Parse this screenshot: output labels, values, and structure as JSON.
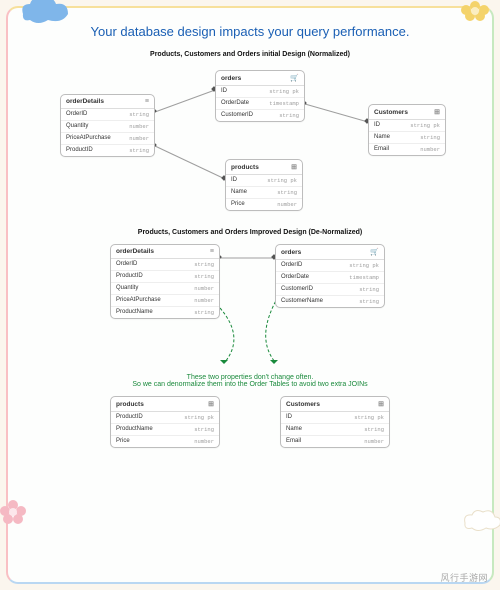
{
  "title": "Your database design impacts your query performance.",
  "section1": {
    "heading": "Products, Customers and Orders initial Design (Normalized)",
    "orderDetails": {
      "name": "orderDetails",
      "cols": [
        {
          "n": "OrderID",
          "t": "string"
        },
        {
          "n": "Quantity",
          "t": "number"
        },
        {
          "n": "PriceAtPurchase",
          "t": "number"
        },
        {
          "n": "ProductID",
          "t": "string"
        }
      ]
    },
    "orders": {
      "name": "orders",
      "cols": [
        {
          "n": "ID",
          "t": "string pk"
        },
        {
          "n": "OrderDate",
          "t": "timestamp"
        },
        {
          "n": "CustomerID",
          "t": "string"
        }
      ]
    },
    "customers": {
      "name": "Customers",
      "cols": [
        {
          "n": "ID",
          "t": "string pk"
        },
        {
          "n": "Name",
          "t": "string"
        },
        {
          "n": "Email",
          "t": "number"
        }
      ]
    },
    "products": {
      "name": "products",
      "cols": [
        {
          "n": "ID",
          "t": "string pk"
        },
        {
          "n": "Name",
          "t": "string"
        },
        {
          "n": "Price",
          "t": "number"
        }
      ]
    }
  },
  "section2": {
    "heading": "Products, Customers and Orders Improved Design (De-Normalized)",
    "orderDetails": {
      "name": "orderDetails",
      "cols": [
        {
          "n": "OrderID",
          "t": "string"
        },
        {
          "n": "ProductID",
          "t": "string"
        },
        {
          "n": "Quantity",
          "t": "number"
        },
        {
          "n": "PriceAtPurchase",
          "t": "number"
        },
        {
          "n": "ProductName",
          "t": "string"
        }
      ]
    },
    "orders": {
      "name": "orders",
      "cols": [
        {
          "n": "OrderID",
          "t": "string pk"
        },
        {
          "n": "OrderDate",
          "t": "timestamp"
        },
        {
          "n": "CustomerID",
          "t": "string"
        },
        {
          "n": "CustomerName",
          "t": "string"
        }
      ]
    },
    "products": {
      "name": "products",
      "cols": [
        {
          "n": "ProductID",
          "t": "string pk"
        },
        {
          "n": "ProductName",
          "t": "string"
        },
        {
          "n": "Price",
          "t": "number"
        }
      ]
    },
    "customers": {
      "name": "Customers",
      "cols": [
        {
          "n": "ID",
          "t": "string pk"
        },
        {
          "n": "Name",
          "t": "string"
        },
        {
          "n": "Email",
          "t": "number"
        }
      ]
    },
    "note1": "These two properties don't change often.",
    "note2": "So we can denormalize them into the Order Tables to avoid two extra JOINs"
  },
  "watermark": "风行手游网",
  "icons": {
    "menu": "≡",
    "cart": "🛒",
    "cube": "⊞"
  }
}
